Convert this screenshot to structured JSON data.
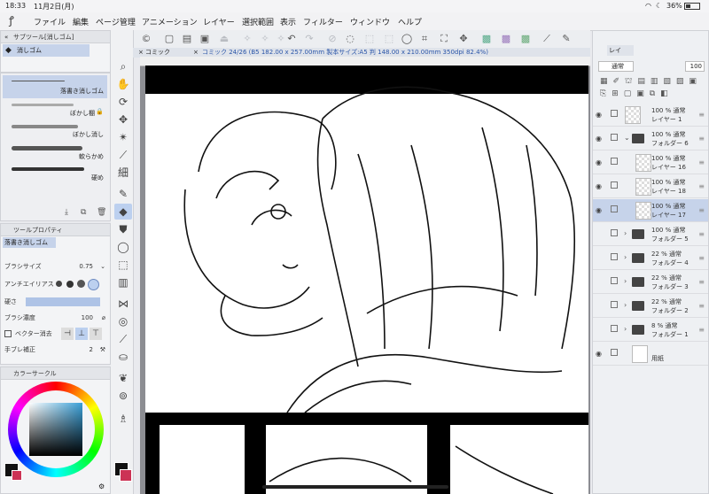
{
  "status_bar": {
    "time": "18:33",
    "date": "11月2日(月)",
    "battery": "36%"
  },
  "menu": {
    "items": [
      "ファイル",
      "編集",
      "ページ管理",
      "アニメーション",
      "レイヤー",
      "選択範囲",
      "表示",
      "フィルター",
      "ウィンドウ",
      "ヘルプ"
    ]
  },
  "doc_tab": {
    "closed_tab": "コミック",
    "active_tab": "コミック 24/26 (B5 182.00 x 257.00mm 製本サイズ:A5 判 148.00 x 210.00mm 350dpi 82.4%)"
  },
  "subtool_panel": {
    "title": "サブツール[消しゴム]",
    "group": "消しゴム",
    "brushes": [
      "落書き消しゴム",
      "ぼかし棚",
      "ぼかし消し",
      "軟らかめ",
      "硬め"
    ]
  },
  "tool_property": {
    "title": "ツールプロパティ",
    "tool_name": "落書き消しゴム",
    "brush_size_label": "ブラシサイズ",
    "brush_size_value": "0.75",
    "antialias_label": "アンチエイリアス",
    "hardness_label": "硬さ",
    "density_label": "ブラシ濃度",
    "density_value": "100",
    "vector_erase_label": "ベクター消去",
    "stabilization_label": "手ブレ補正",
    "stabilization_value": "2"
  },
  "color_panel": {
    "title": "カラーサークル",
    "main_color": "#111111",
    "sub_color": "#cc3355"
  },
  "layer_panel": {
    "tab": "レイ",
    "blend_mode": "通常",
    "opacity": "100",
    "layers": [
      {
        "opacity": "100 % 通常",
        "name": "レイヤー 1",
        "type": "layer"
      },
      {
        "opacity": "100 % 通常",
        "name": "フォルダー 6",
        "type": "folder"
      },
      {
        "opacity": "100 % 通常",
        "name": "レイヤー 16",
        "type": "layer"
      },
      {
        "opacity": "100 % 通常",
        "name": "レイヤー 18",
        "type": "layer"
      },
      {
        "opacity": "100 % 通常",
        "name": "レイヤー 17",
        "type": "layer"
      },
      {
        "opacity": "100 % 通常",
        "name": "フォルダー 5",
        "type": "folder"
      },
      {
        "opacity": "22 % 通常",
        "name": "フォルダー 4",
        "type": "folder"
      },
      {
        "opacity": "22 % 通常",
        "name": "フォルダー 3",
        "type": "folder"
      },
      {
        "opacity": "22 % 通常",
        "name": "フォルダー 2",
        "type": "folder"
      },
      {
        "opacity": "8 % 通常",
        "name": "フォルダー 1",
        "type": "folder"
      },
      {
        "opacity": "",
        "name": "用紙",
        "type": "paper"
      }
    ]
  },
  "colors": {
    "accent": "#bcd0ef",
    "selected_row": "#c6d3ea"
  }
}
